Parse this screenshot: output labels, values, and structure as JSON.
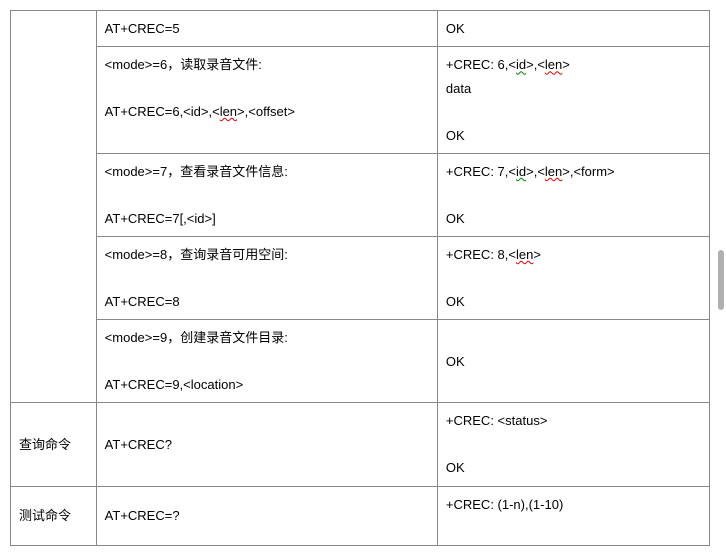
{
  "rows": [
    {
      "label_col1": "",
      "left_line1": "AT+CREC=5",
      "right_line1": "OK"
    },
    {
      "left_line1": "<mode>=6，读取录音文件:",
      "left_line2": "AT+CREC=6,<id>,<len>,<offset>",
      "right_line1": "+CREC: 6,<id>,<len>",
      "right_line2": "data",
      "right_line3": "OK"
    },
    {
      "left_line1": "<mode>=7，查看录音文件信息:",
      "left_line2": "AT+CREC=7[,<id>]",
      "right_line1": "+CREC: 7,<id>,<len>,<form>",
      "right_line2": "OK"
    },
    {
      "left_line1": "<mode>=8，查询录音可用空间:",
      "left_line2": "AT+CREC=8",
      "right_line1": "+CREC: 8,<len>",
      "right_line2": "OK"
    },
    {
      "left_line1": "<mode>=9，创建录音文件目录:",
      "left_line2": "AT+CREC=9,<location>",
      "right_line1": "OK"
    },
    {
      "label_col1": "查询命令",
      "left_line1": "AT+CREC?",
      "right_line1": "+CREC: <status>",
      "right_line2": "OK"
    },
    {
      "label_col1": "测试命令",
      "left_line1": "AT+CREC=?",
      "right_line1": "+CREC: (1-n),(1-10)"
    }
  ]
}
